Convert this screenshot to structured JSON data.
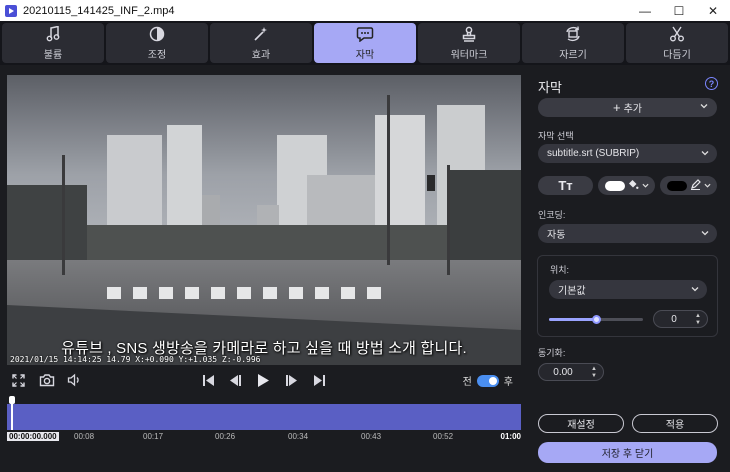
{
  "window": {
    "title": "20210115_141425_INF_2.mp4",
    "controls": {
      "minimize": "—",
      "maximize": "☐",
      "close": "✕"
    }
  },
  "tabs": [
    {
      "label": "불륨",
      "icon": "music-note-icon",
      "active": false
    },
    {
      "label": "조정",
      "icon": "contrast-icon",
      "active": false
    },
    {
      "label": "효과",
      "icon": "magic-wand-icon",
      "active": false
    },
    {
      "label": "자막",
      "icon": "speech-bubble-icon",
      "active": true
    },
    {
      "label": "워터마크",
      "icon": "stamp-icon",
      "active": false
    },
    {
      "label": "자르기",
      "icon": "crop-rotate-icon",
      "active": false
    },
    {
      "label": "다듬기",
      "icon": "scissors-icon",
      "active": false
    }
  ],
  "video": {
    "subtitle": "유튜브 , SNS 생방송을 카메라로 하고 싶을 때 방법 소개 합니다.",
    "stamp": "2021/01/15 14:14:25 14.79 X:+0.090 Y:+1.035 Z:-0.996"
  },
  "player": {
    "toggle_before": "전",
    "toggle_after": "후",
    "toggle_on": true
  },
  "timeline": {
    "current": "00:00:00.000",
    "ticks": [
      "00:08",
      "00:17",
      "00:26",
      "00:34",
      "00:43",
      "00:52"
    ],
    "end": "01:00",
    "position": 0.0
  },
  "panel": {
    "title": "자막",
    "add_label": "추가",
    "subtitle_select_label": "자막 선택",
    "subtitle_select_value": "subtitle.srt (SUBRIP)",
    "text_style_label": "Tт",
    "fill_color": "#ffffff",
    "outline_color": "#000000",
    "encoding_label": "인코딩:",
    "encoding_value": "자동",
    "position_label": "위치:",
    "position_value": "기본값",
    "offset_value": "0",
    "slider_value": 0.5,
    "sync_label": "동기화:",
    "sync_value": "0.00",
    "reset_label": "재설정",
    "apply_label": "적용",
    "save_close_label": "저장 후 닫기"
  },
  "colors": {
    "accent": "#a6a8f5",
    "timeline": "#5a5fc4",
    "toggle": "#4a8ef0",
    "background": "#1b1c20"
  }
}
